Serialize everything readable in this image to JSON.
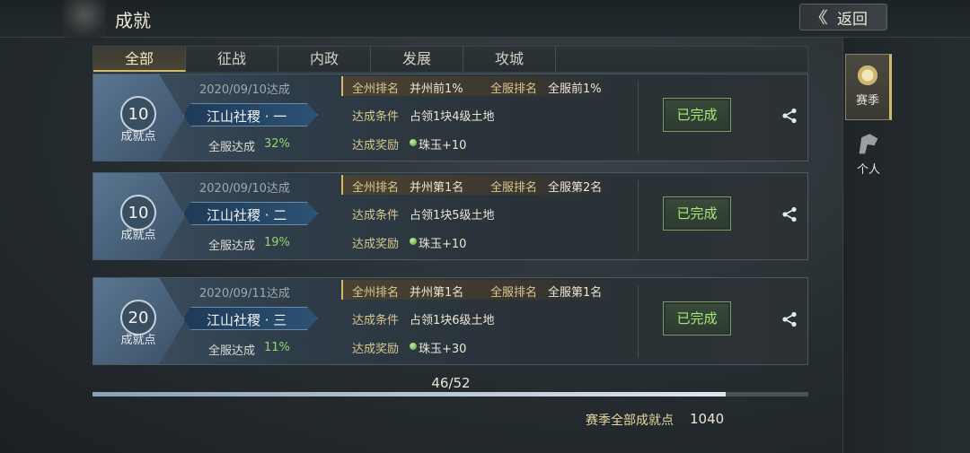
{
  "header": {
    "title": "成就",
    "back_label": "返回"
  },
  "side_tabs": [
    {
      "label": "赛季",
      "icon": "season-medal-icon",
      "active": true
    },
    {
      "label": "个人",
      "icon": "person-flag-icon",
      "active": false
    }
  ],
  "tabs": [
    {
      "label": "全部",
      "active": true
    },
    {
      "label": "征战",
      "active": false
    },
    {
      "label": "内政",
      "active": false
    },
    {
      "label": "发展",
      "active": false
    },
    {
      "label": "攻城",
      "active": false
    }
  ],
  "cards": [
    {
      "points": "10",
      "points_label": "成就点",
      "date": "2020/09/10达成",
      "name": "江山社稷 · 一",
      "rate_label": "全服达成",
      "rate_value": "32%",
      "rank_key1": "全州排名",
      "rank_val1": "并州前1%",
      "rank_key2": "全服排名",
      "rank_val2": "全服前1%",
      "cond_key": "达成条件",
      "cond_val": "占领1块4级土地",
      "reward_key": "达成奖励",
      "reward_val": "珠玉+10",
      "status": "已完成"
    },
    {
      "points": "10",
      "points_label": "成就点",
      "date": "2020/09/10达成",
      "name": "江山社稷 · 二",
      "rate_label": "全服达成",
      "rate_value": "19%",
      "rank_key1": "全州排名",
      "rank_val1": "并州第1名",
      "rank_key2": "全服排名",
      "rank_val2": "全服第2名",
      "cond_key": "达成条件",
      "cond_val": "占领1块5级土地",
      "reward_key": "达成奖励",
      "reward_val": "珠玉+10",
      "status": "已完成"
    },
    {
      "points": "20",
      "points_label": "成就点",
      "date": "2020/09/11达成",
      "name": "江山社稷 · 三",
      "rate_label": "全服达成",
      "rate_value": "11%",
      "rank_key1": "全州排名",
      "rank_val1": "并州第1名",
      "rank_key2": "全服排名",
      "rank_val2": "全服第1名",
      "cond_key": "达成条件",
      "cond_val": "占领1块6级土地",
      "reward_key": "达成奖励",
      "reward_val": "珠玉+30",
      "status": "已完成"
    }
  ],
  "progress": {
    "text": "46/52",
    "done": 46,
    "total": 52
  },
  "footer": {
    "total_label": "赛季全部成就点",
    "total_value": "1040"
  },
  "colors": {
    "accent_gold": "#d4b86a",
    "success_green": "#a8e878",
    "rate_green": "#8fd86a"
  }
}
